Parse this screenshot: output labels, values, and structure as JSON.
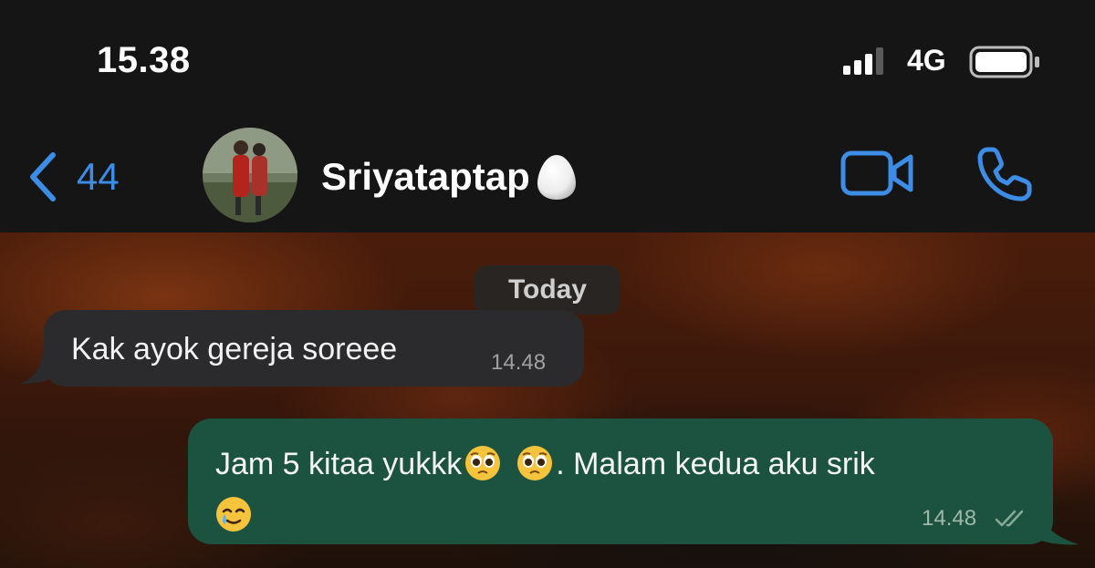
{
  "status_bar": {
    "time": "15.38",
    "network": "4G"
  },
  "header": {
    "back_count": "44",
    "contact_name": "Sriyataptap",
    "contact_emoji": "egg-icon"
  },
  "chat": {
    "date_label": "Today",
    "messages": [
      {
        "direction": "incoming",
        "text": "Kak ayok gereja soreee",
        "time": "14.48"
      },
      {
        "direction": "outgoing",
        "text_part1": "Jam 5 kitaa yukkk",
        "text_part2": ". Malam kedua aku srik",
        "emojis": [
          "pleading-face-emoji",
          "pleading-face-emoji",
          "smiling-face-with-tear-emoji"
        ],
        "time": "14.48",
        "status": "read"
      }
    ]
  },
  "colors": {
    "accent": "#3d8de6",
    "incoming_bubble": "#2b2b2d",
    "outgoing_bubble": "#1c5340"
  }
}
